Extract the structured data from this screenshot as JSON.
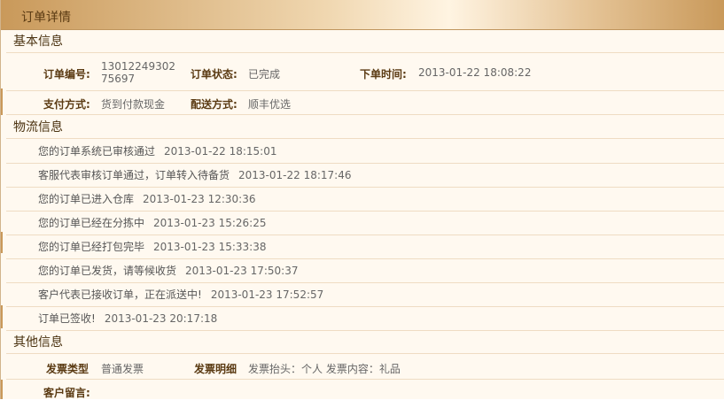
{
  "panel": {
    "title": "订单详情"
  },
  "basic": {
    "section_title": "基本信息",
    "order_no_label": "订单编号:",
    "order_no_line1": "13012249302",
    "order_no_line2": "75697",
    "status_label": "订单状态:",
    "status_value": "已完成",
    "time_label": "下单时间:",
    "time_value": "2013-01-22 18:08:22",
    "payment_label": "支付方式:",
    "payment_value": "货到付款现金",
    "delivery_label": "配送方式:",
    "delivery_value": "顺丰优选"
  },
  "logistics": {
    "section_title": "物流信息",
    "entries": [
      {
        "text": "您的订单系统已审核通过",
        "time": "2013-01-22 18:15:01"
      },
      {
        "text": "客服代表审核订单通过，订单转入待备货",
        "time": "2013-01-22 18:17:46"
      },
      {
        "text": "您的订单已进入仓库",
        "time": "2013-01-23 12:30:36"
      },
      {
        "text": "您的订单已经在分拣中",
        "time": "2013-01-23 15:26:25"
      },
      {
        "text": "您的订单已经打包完毕",
        "time": "2013-01-23 15:33:38"
      },
      {
        "text": "您的订单已发货，请等候收货",
        "time": "2013-01-23 17:50:37"
      },
      {
        "text": "客户代表已接收订单，正在派送中!",
        "time": "2013-01-23 17:52:57"
      },
      {
        "text": "订单已签收!",
        "time": "2013-01-23 20:17:18"
      }
    ]
  },
  "other": {
    "section_title": "其他信息",
    "invoice_type_label": "发票类型",
    "invoice_type_value": "普通发票",
    "invoice_detail_label": "发票明细",
    "invoice_detail_value": "发票抬头：个人 发票内容：礼品",
    "message_label": "客户留言:"
  }
}
